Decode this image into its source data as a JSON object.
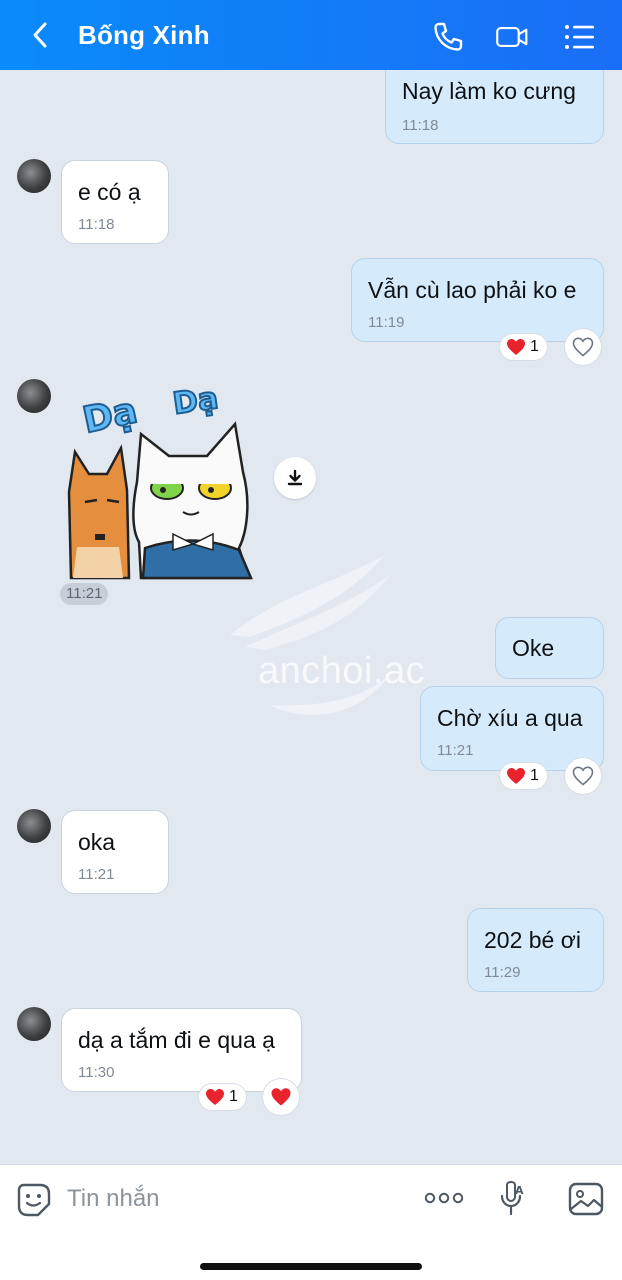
{
  "header": {
    "title": "Bống Xinh",
    "icons": [
      "back-icon",
      "phone-icon",
      "video-call-icon",
      "menu-list-icon"
    ]
  },
  "messages": [
    {
      "dir": "out",
      "text": "Nay làm ko cưng",
      "time": "11:18"
    },
    {
      "dir": "in",
      "text": "e có ạ",
      "time": "11:18"
    },
    {
      "dir": "out",
      "text": "Vẫn cù lao phải ko e",
      "time": "11:19",
      "reaction": {
        "emoji": "heart",
        "count": "1"
      }
    },
    {
      "dir": "in",
      "type": "sticker",
      "sticker_text": [
        "Dạ",
        "Dạ"
      ],
      "time": "11:21"
    },
    {
      "dir": "out",
      "text": "Oke"
    },
    {
      "dir": "out",
      "text": "Chờ xíu a qua",
      "time": "11:21",
      "reaction": {
        "emoji": "heart",
        "count": "1"
      }
    },
    {
      "dir": "in",
      "text": "oka",
      "time": "11:21"
    },
    {
      "dir": "out",
      "text": "202 bé ơi",
      "time": "11:29"
    },
    {
      "dir": "in",
      "text": "dạ a tắm đi e qua ạ",
      "time": "11:30",
      "reaction": {
        "emoji": "heart",
        "count": "1"
      }
    }
  ],
  "watermark": "anchoi.ac",
  "composer": {
    "placeholder": "Tin nhắn",
    "icons": [
      "emoji-sticker-icon",
      "more-options-icon",
      "voice-text-icon",
      "image-gallery-icon"
    ]
  },
  "colors": {
    "header": "#0a8bfb",
    "background": "#e2e8f0",
    "outgoing_bubble": "#d5ebfb",
    "incoming_bubble": "#ffffff",
    "heart": "#e8232e"
  }
}
